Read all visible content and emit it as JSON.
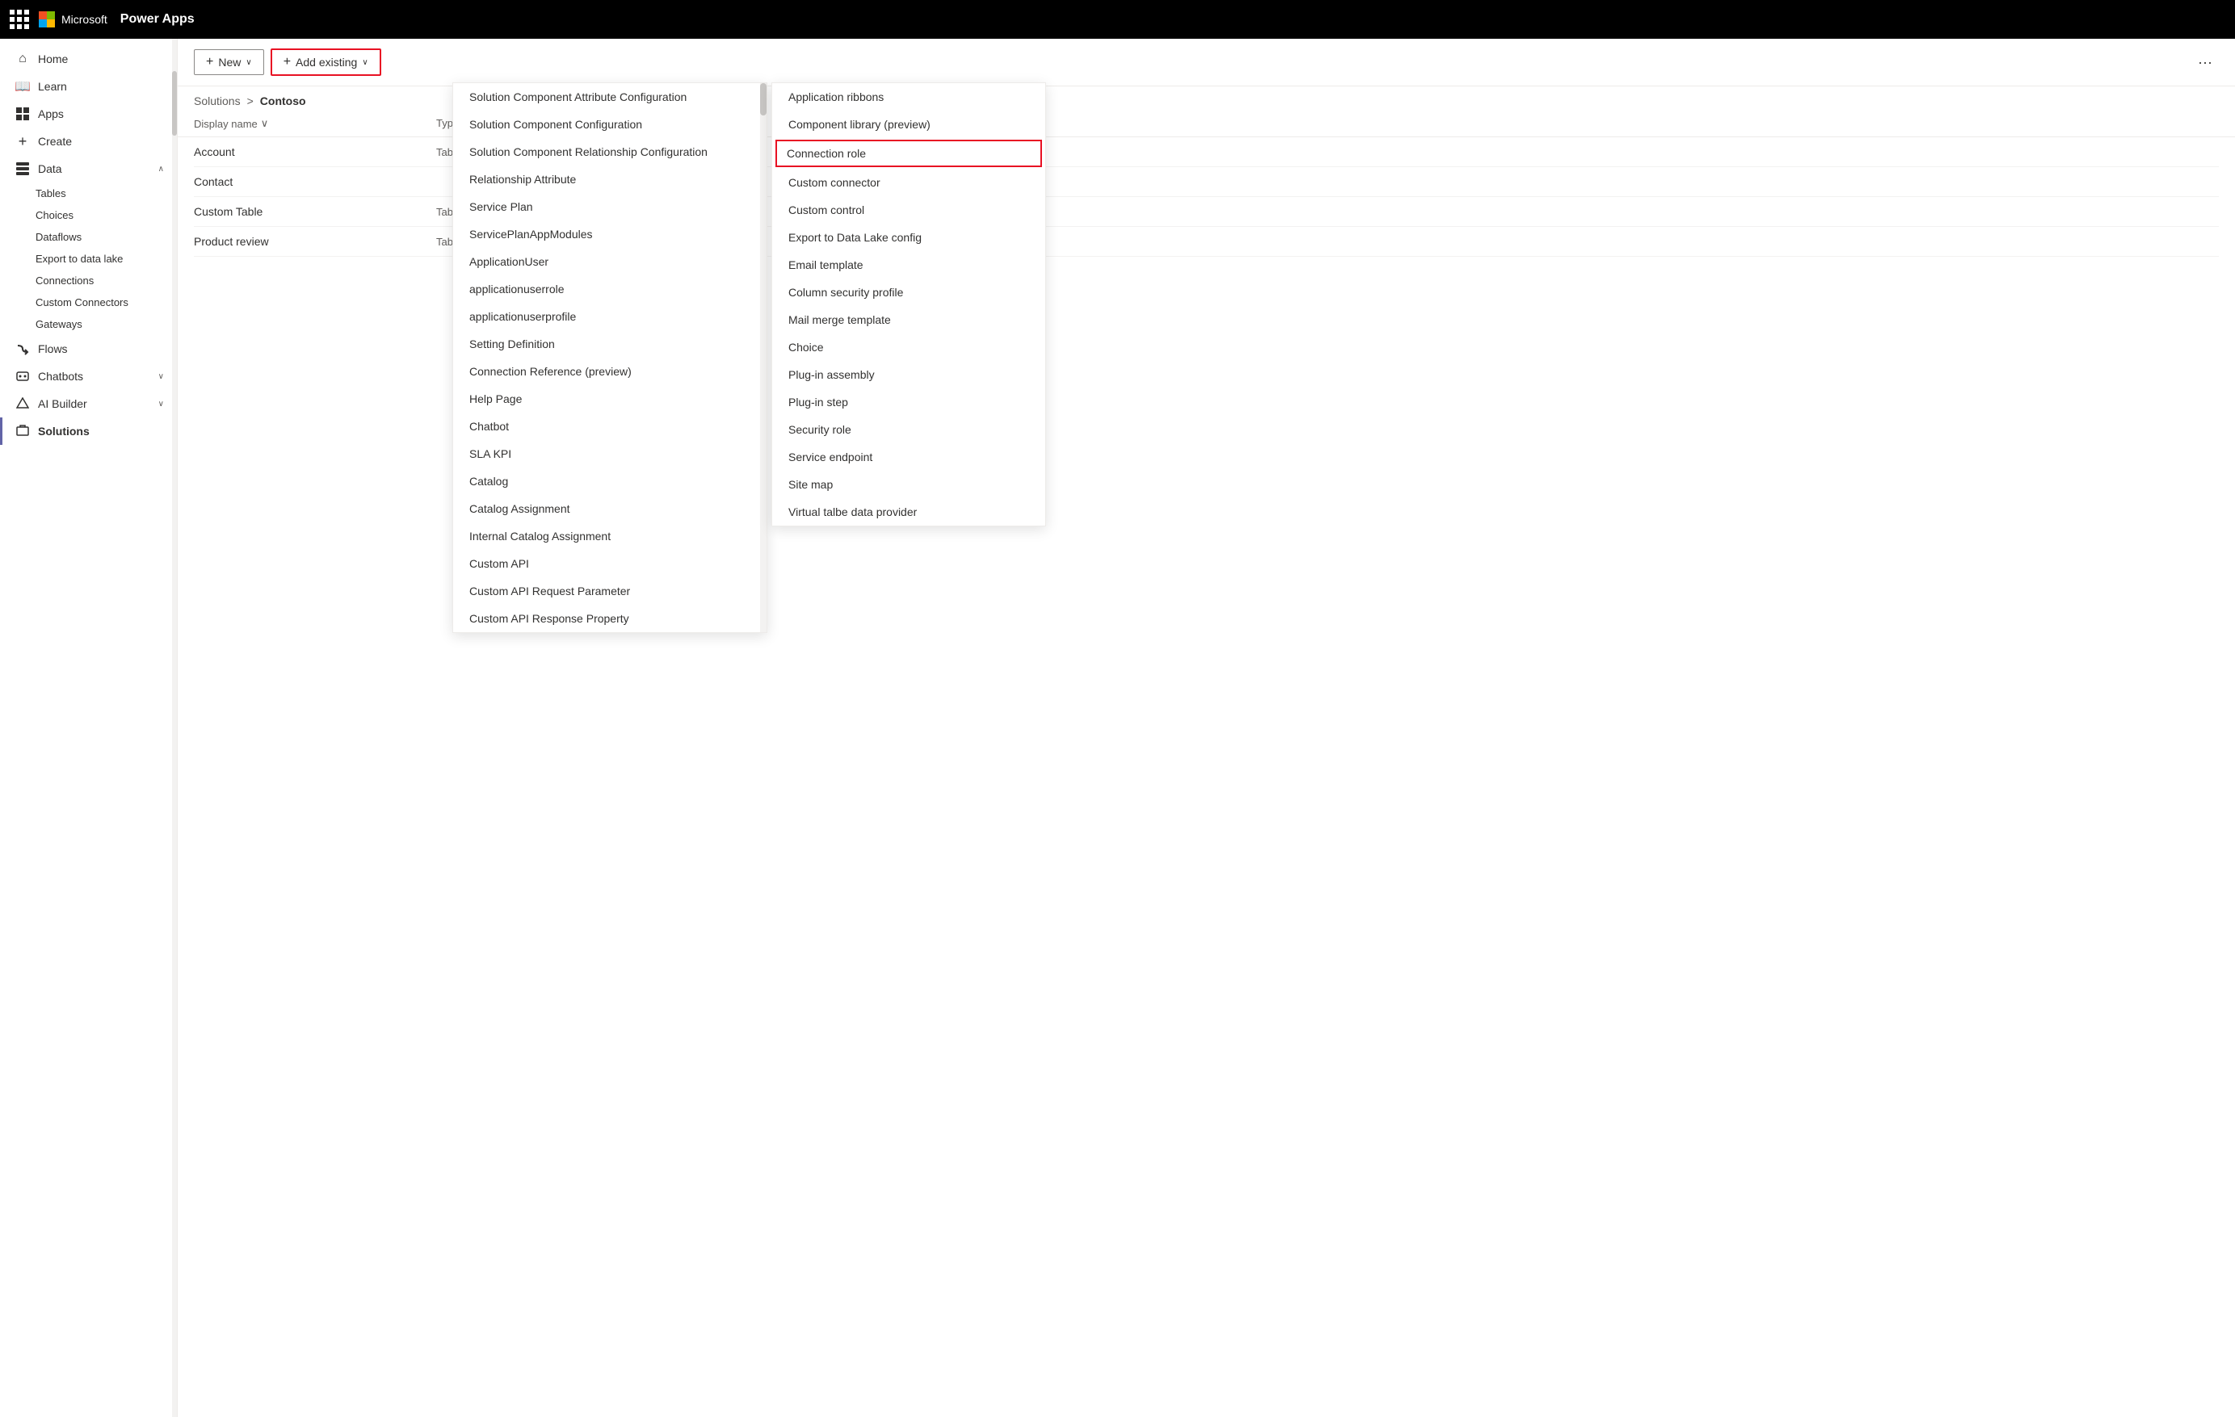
{
  "topbar": {
    "product_name": "Power Apps",
    "microsoft_label": "Microsoft"
  },
  "sidebar": {
    "items": [
      {
        "id": "home",
        "label": "Home",
        "icon": "⌂",
        "has_chevron": false,
        "active": false
      },
      {
        "id": "learn",
        "label": "Learn",
        "icon": "📖",
        "has_chevron": false,
        "active": false
      },
      {
        "id": "apps",
        "label": "Apps",
        "icon": "⊞",
        "has_chevron": false,
        "active": false
      },
      {
        "id": "create",
        "label": "Create",
        "icon": "+",
        "has_chevron": false,
        "active": false
      },
      {
        "id": "data",
        "label": "Data",
        "icon": "⊟",
        "has_chevron": true,
        "expanded": true,
        "active": false
      },
      {
        "id": "flows",
        "label": "Flows",
        "icon": "↻",
        "has_chevron": false,
        "active": false
      },
      {
        "id": "chatbots",
        "label": "Chatbots",
        "icon": "💬",
        "has_chevron": true,
        "active": false
      },
      {
        "id": "ai_builder",
        "label": "AI Builder",
        "icon": "◈",
        "has_chevron": true,
        "active": false
      },
      {
        "id": "solutions",
        "label": "Solutions",
        "icon": "⚙",
        "has_chevron": false,
        "active": true
      }
    ],
    "data_subitems": [
      {
        "id": "tables",
        "label": "Tables"
      },
      {
        "id": "choices",
        "label": "Choices"
      },
      {
        "id": "dataflows",
        "label": "Dataflows"
      },
      {
        "id": "export_data_lake",
        "label": "Export to data lake"
      },
      {
        "id": "connections",
        "label": "Connections"
      },
      {
        "id": "custom_connectors",
        "label": "Custom Connectors"
      },
      {
        "id": "gateways",
        "label": "Gateways"
      }
    ]
  },
  "toolbar": {
    "new_label": "New",
    "add_existing_label": "Add existing",
    "new_icon": "+",
    "add_icon": "+"
  },
  "breadcrumb": {
    "solutions_label": "Solutions",
    "separator": ">",
    "current": "Contoso"
  },
  "main_table": {
    "col_display_name": "Display name",
    "col_type": "Type",
    "rows": [
      {
        "name": "Account",
        "type": "Table"
      },
      {
        "name": "Contact",
        "type": ""
      },
      {
        "name": "Custom Table",
        "type": "Table"
      },
      {
        "name": "Product review",
        "type": "Table"
      }
    ]
  },
  "dropdown1": {
    "items": [
      "Solution Component Attribute Configuration",
      "Solution Component Configuration",
      "Solution Component Relationship Configuration",
      "Relationship Attribute",
      "Service Plan",
      "ServicePlanAppModules",
      "ApplicationUser",
      "applicationuserrole",
      "applicationuserprofile",
      "Setting Definition",
      "Connection Reference (preview)",
      "Help Page",
      "Chatbot",
      "SLA KPI",
      "Catalog",
      "Catalog Assignment",
      "Internal Catalog Assignment",
      "Custom API",
      "Custom API Request Parameter",
      "Custom API Response Property"
    ]
  },
  "dropdown2": {
    "items": [
      "Application ribbons",
      "Component library (preview)",
      "Connection role",
      "Custom connector",
      "Custom control",
      "Export to Data Lake config",
      "Email template",
      "Column security profile",
      "Mail merge template",
      "Choice",
      "Plug-in assembly",
      "Plug-in step",
      "Security role",
      "Service endpoint",
      "Site map",
      "Virtual talbe data provider"
    ],
    "highlighted_item": "Connection role"
  },
  "header_right": {
    "more_icon": "···"
  }
}
